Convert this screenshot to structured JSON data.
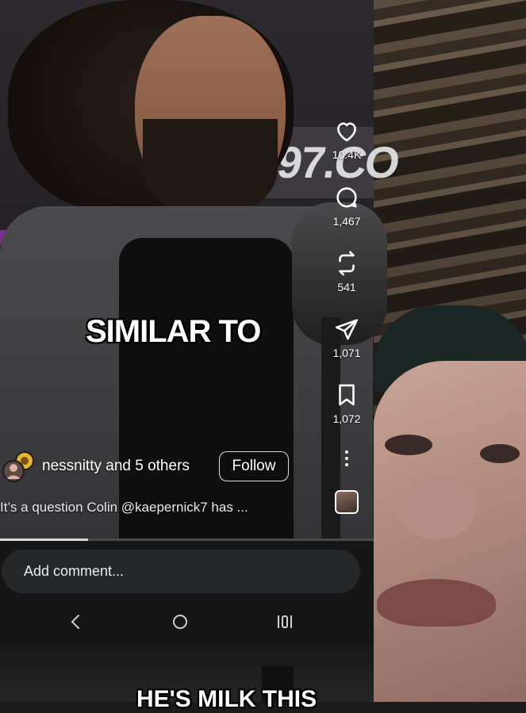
{
  "post": {
    "caption_overlay": "SIMILAR TO",
    "author": {
      "name": "nessnitty",
      "suffix": "and 5 others",
      "follow_label": "Follow"
    },
    "caption": "It’s a question Colin @kaepernick7 has ..."
  },
  "studio_sign": "97.CO",
  "rail": {
    "likes": "10.4K",
    "comments": "1,467",
    "reposts": "541",
    "shares": "1,071",
    "saves": "1,072"
  },
  "playback": {
    "progress": 0.235
  },
  "comment_bar": {
    "placeholder": "Add comment..."
  },
  "reaction_video": {
    "caption_overlay": "HE'S MILK THIS"
  },
  "icons": [
    "heart-icon",
    "comment-icon",
    "repost-icon",
    "send-icon",
    "bookmark-icon",
    "more-icon",
    "back-icon",
    "home-icon",
    "recents-icon"
  ],
  "colors": {
    "panel": "#161616",
    "input": "#262729",
    "text": "#ffffff"
  }
}
